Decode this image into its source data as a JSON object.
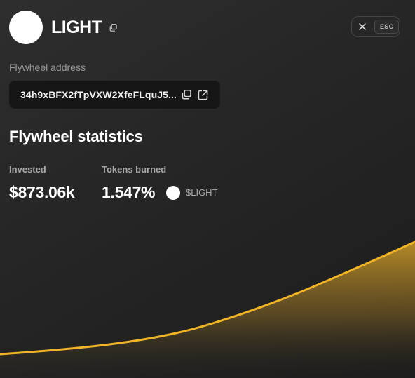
{
  "header": {
    "token_name": "LIGHT",
    "close_key_label": "ESC"
  },
  "address": {
    "label": "Flywheel address",
    "value": "34h9xBFX2fTpVXW2XfeFLquJ5..."
  },
  "statistics": {
    "title": "Flywheel statistics",
    "invested": {
      "label": "Invested",
      "value": "$873.06k"
    },
    "tokens_burned": {
      "label": "Tokens burned",
      "value": "1.547%",
      "ticker": "$LIGHT"
    }
  },
  "colors": {
    "accent": "#f0b429",
    "background": "#222222",
    "address_box": "#161616",
    "muted_text": "#9a9a9a"
  },
  "icons": {
    "copy": "copy-icon",
    "close": "close-icon",
    "external_link": "external-link-icon",
    "token_logo": "token-logo"
  }
}
